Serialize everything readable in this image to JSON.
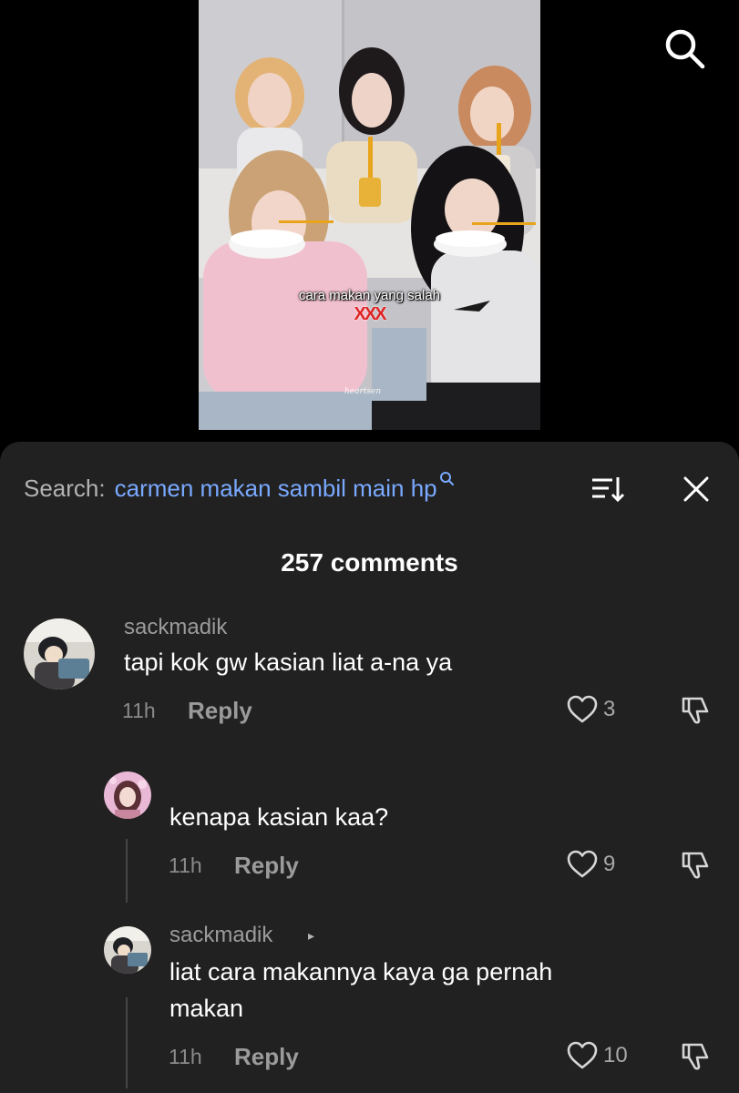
{
  "video": {
    "caption": "cara makan yang salah",
    "x_marks": "XXX",
    "watermark": "heartsen"
  },
  "top_bar": {
    "search_icon": "search-icon"
  },
  "sheet": {
    "search_prefix": "Search:",
    "search_query": "carmen makan sambil main hp",
    "search_icon": "magnifier-icon",
    "sort_icon": "sort-icon",
    "close_icon": "close-icon",
    "comment_count": "257 comments"
  },
  "comments": [
    {
      "username": "sackmadik",
      "text": "tapi kok gw kasian liat a-na ya",
      "time": "11h",
      "reply_label": "Reply",
      "likes": "3"
    },
    {
      "username": "",
      "text": "kenapa kasian kaa?",
      "time": "11h",
      "reply_label": "Reply",
      "likes": "9"
    },
    {
      "username": "sackmadik",
      "username_caret": "▸",
      "text_line1": "liat cara makannya kaya ga pernah",
      "text_line2": "makan",
      "time": "11h",
      "reply_label": "Reply",
      "likes": "10"
    }
  ],
  "colors": {
    "sheet_bg": "#212121",
    "query_blue": "#79a9ff",
    "x_red": "#e02424"
  }
}
